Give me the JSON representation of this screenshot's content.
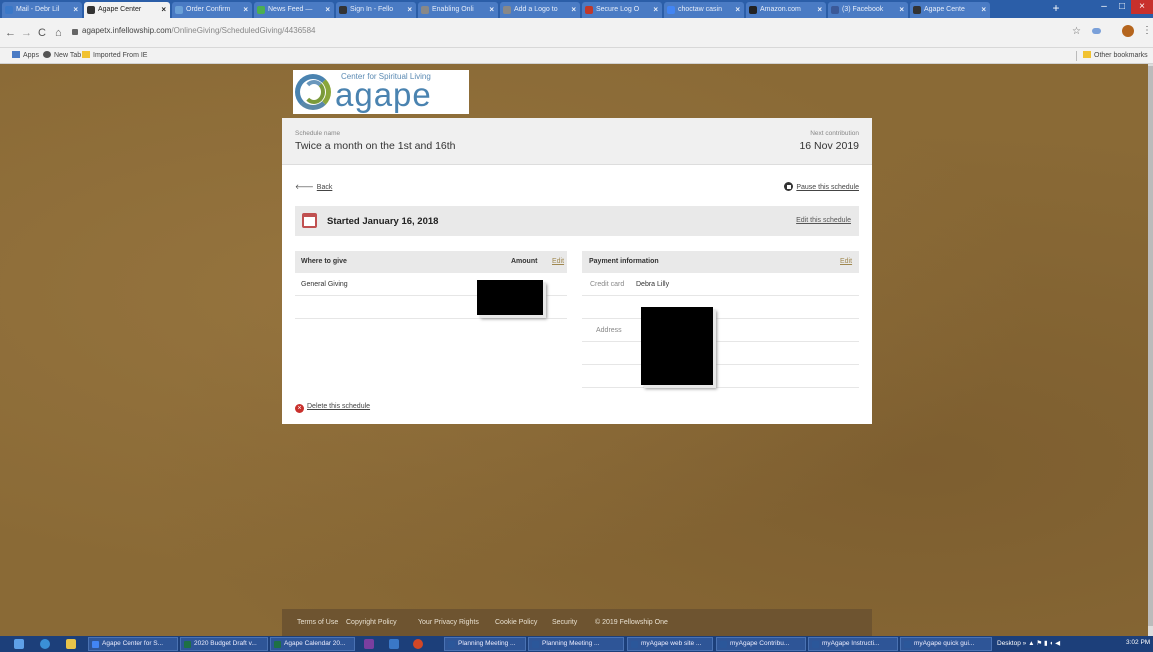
{
  "browser": {
    "tabs": [
      {
        "label": "Mail - Debr Lil",
        "color": "#3a78c8"
      },
      {
        "label": "Agape Center",
        "color": "#333333"
      },
      {
        "label": "Order Confirm",
        "color": "#6aa0d8"
      },
      {
        "label": "News Feed —",
        "color": "#4caf50"
      },
      {
        "label": "Sign In - Fello",
        "color": "#333333"
      },
      {
        "label": "Enabling Onli",
        "color": "#888888"
      },
      {
        "label": "Add a Logo to",
        "color": "#888888"
      },
      {
        "label": "Secure Log O",
        "color": "#c0392b"
      },
      {
        "label": "choctaw casin",
        "color": "#4285f4"
      },
      {
        "label": "Amazon.com",
        "color": "#222222"
      },
      {
        "label": "(3) Facebook",
        "color": "#3b5998"
      },
      {
        "label": "Agape Cente",
        "color": "#333333"
      }
    ],
    "active_tab_index": 1,
    "tab_close_glyph": "×",
    "new_tab_glyph": "+",
    "url_host": "agapetx.infellowship.com",
    "url_path": "/OnlineGiving/ScheduledGiving/4436584",
    "bookmarks": {
      "apps": "Apps",
      "new_tab": "New Tab",
      "imported": "Imported From IE",
      "other": "Other bookmarks"
    }
  },
  "logo": {
    "tagline": "Center for Spiritual Living",
    "wordmark": "agape"
  },
  "schedule": {
    "name_label": "Schedule name",
    "name": "Twice a month on the 1st and 16th",
    "next_label": "Next contribution",
    "next_date": "16 Nov 2019",
    "back": "Back",
    "pause": "Pause this schedule",
    "started": "Started January 16, 2018",
    "edit_schedule": "Edit this schedule",
    "delete": "Delete this schedule"
  },
  "give_panel": {
    "col_where": "Where to give",
    "col_amount": "Amount",
    "edit": "Edit",
    "rows": [
      {
        "fund": "General Giving"
      }
    ]
  },
  "payment_panel": {
    "title": "Payment information",
    "edit": "Edit",
    "credit_card_label": "Credit card",
    "card_holder": "Debra Lilly",
    "address_label": "Address"
  },
  "footer": {
    "links": [
      "Terms of Use",
      "Copyright Policy",
      "Your Privacy Rights",
      "Cookie Policy",
      "Security"
    ],
    "copyright": "© 2019 Fellowship One"
  },
  "taskbar": {
    "items": [
      {
        "label": "Agape Center for S...",
        "color": "#4285f4"
      },
      {
        "label": "2020 Budget Draft v...",
        "color": "#1e7145"
      },
      {
        "label": "Agape Calendar 20...",
        "color": "#1e7145"
      },
      {
        "label": "Planning Meeting ...",
        "color": "#2b579a"
      },
      {
        "label": "Planning Meeting ...",
        "color": "#2b579a"
      },
      {
        "label": "myAgape web site ...",
        "color": "#2b579a"
      },
      {
        "label": "myAgape Contribu...",
        "color": "#2b579a"
      },
      {
        "label": "myAgape Instructi...",
        "color": "#2b579a"
      },
      {
        "label": "myAgape quick gui...",
        "color": "#2b579a"
      }
    ],
    "desktop": "Desktop",
    "clock": "3:02 PM"
  }
}
